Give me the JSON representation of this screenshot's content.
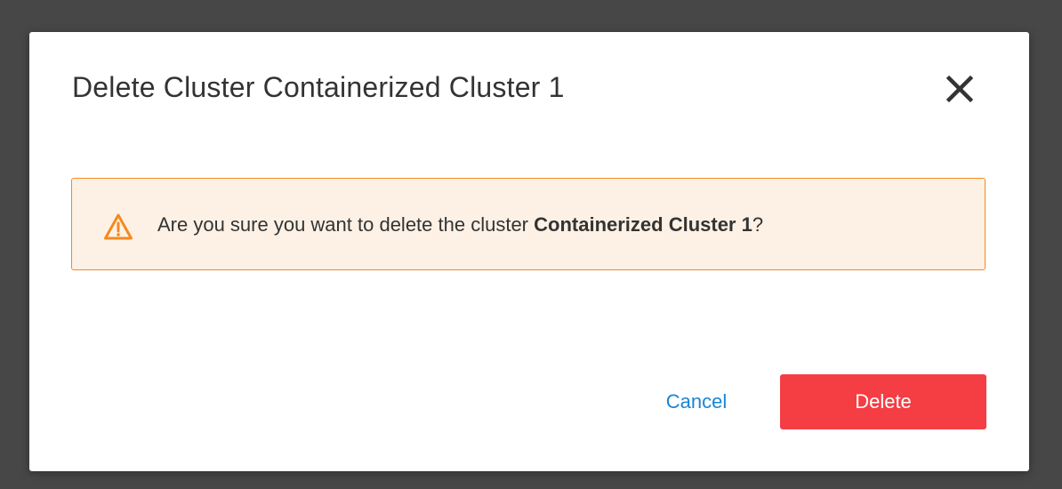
{
  "dialog": {
    "title": "Delete Cluster Containerized Cluster 1",
    "close_icon": "close-icon",
    "alert": {
      "icon": "warning-icon",
      "text_prefix": "Are you sure you want to delete the cluster ",
      "cluster_name": "Containerized Cluster 1",
      "text_suffix": "?"
    },
    "cancel_label": "Cancel",
    "delete_label": "Delete"
  },
  "colors": {
    "overlay": "#474747",
    "alert_background": "#fdf1e6",
    "alert_border": "#f5891f",
    "warning_icon": "#f5891f",
    "link_blue": "#1a85d6",
    "danger_red": "#f53d44"
  }
}
